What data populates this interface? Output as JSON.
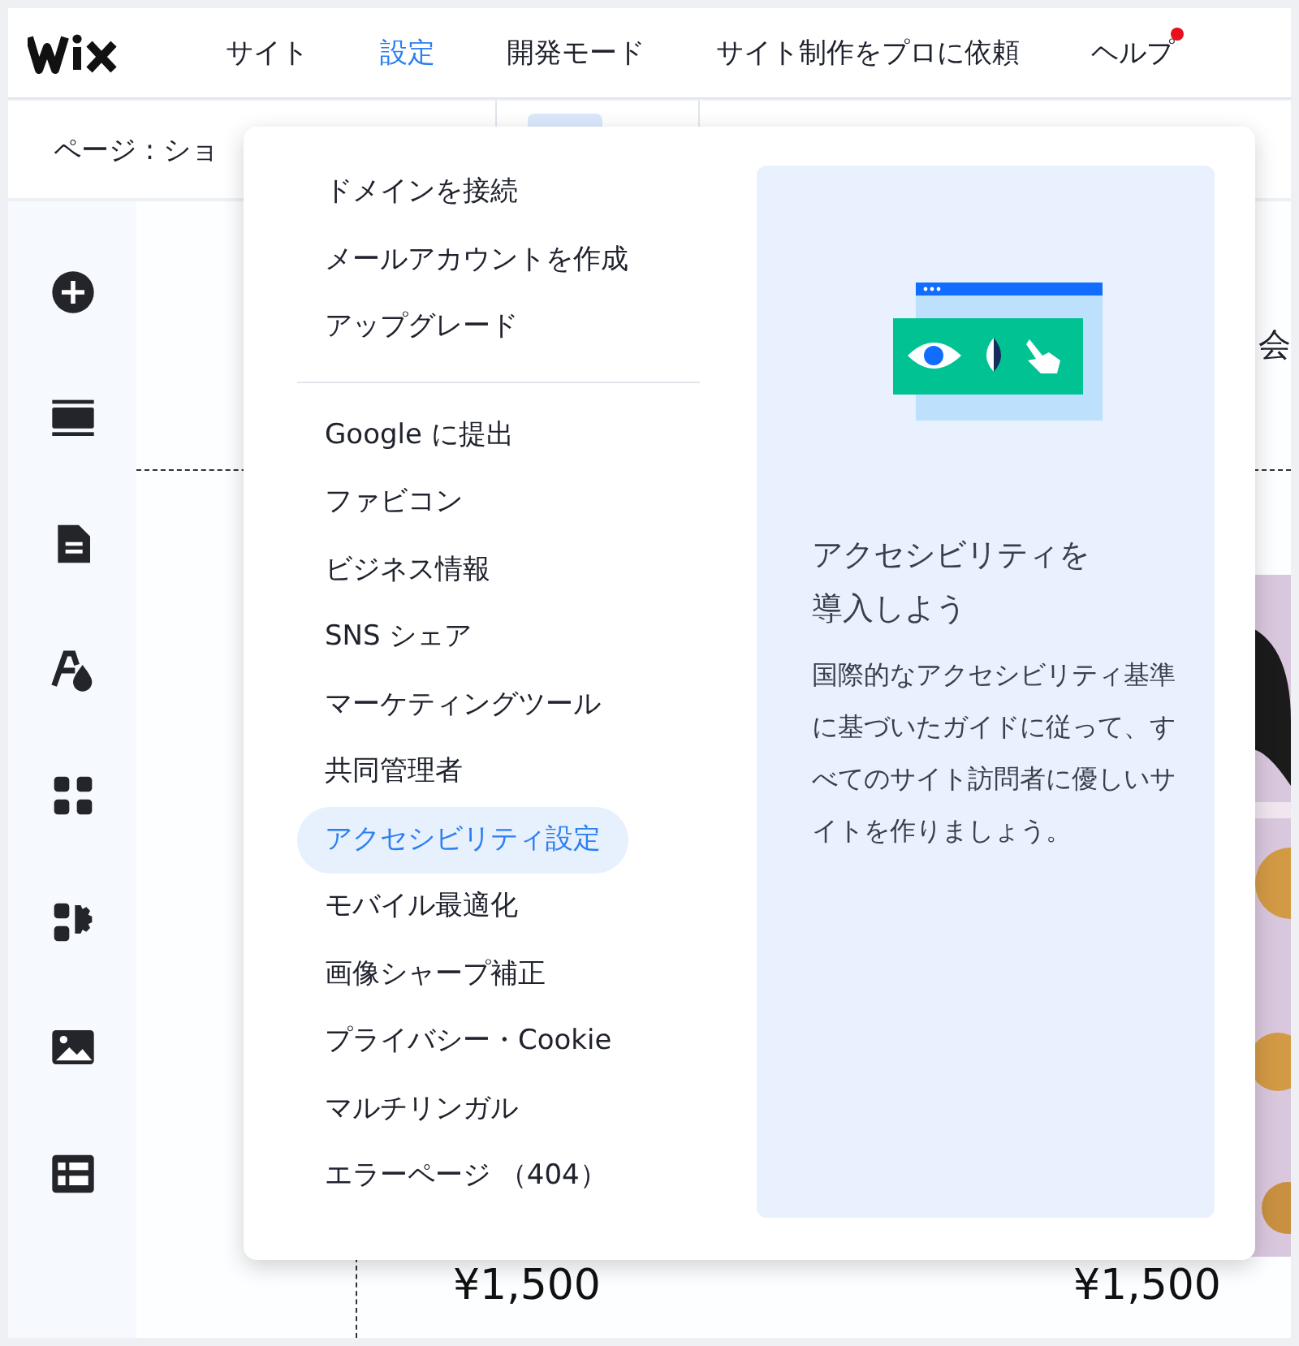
{
  "nav": {
    "tabs": [
      {
        "label": "サイト",
        "selected": false,
        "badge": false
      },
      {
        "label": "設定",
        "selected": true,
        "badge": false
      },
      {
        "label": "開発モード",
        "selected": false,
        "badge": false
      },
      {
        "label": "サイト制作をプロに依頼",
        "selected": false,
        "badge": false
      },
      {
        "label": "ヘルプ",
        "selected": false,
        "badge": true
      }
    ]
  },
  "page_bar": {
    "page_label": "ページ : ショ"
  },
  "canvas": {
    "side_text": "会",
    "prices": [
      "¥1,500",
      "¥1,500"
    ]
  },
  "menu": {
    "sections": [
      {
        "items": [
          {
            "label": "ドメインを接続",
            "selected": false
          },
          {
            "label": "メールアカウントを作成",
            "selected": false
          },
          {
            "label": "アップグレード",
            "selected": false
          }
        ]
      },
      {
        "items": [
          {
            "label": "Google に提出",
            "selected": false
          },
          {
            "label": "ファビコン",
            "selected": false
          },
          {
            "label": "ビジネス情報",
            "selected": false
          },
          {
            "label": "SNS シェア",
            "selected": false
          },
          {
            "label": "マーケティングツール",
            "selected": false
          },
          {
            "label": "共同管理者",
            "selected": false
          },
          {
            "label": "アクセシビリティ設定",
            "selected": true
          },
          {
            "label": "モバイル最適化",
            "selected": false
          },
          {
            "label": "画像シャープ補正",
            "selected": false
          },
          {
            "label": "プライバシー・Cookie",
            "selected": false
          },
          {
            "label": "マルチリンガル",
            "selected": false
          },
          {
            "label": "エラーページ （404）",
            "selected": false
          }
        ]
      }
    ],
    "promo": {
      "title": "アクセシビリティを導入しよう",
      "body": "国際的なアクセシビリティ基準に基づいたガイドに従って、すべてのサイト訪問者に優しいサイトを作りましょう。"
    }
  }
}
